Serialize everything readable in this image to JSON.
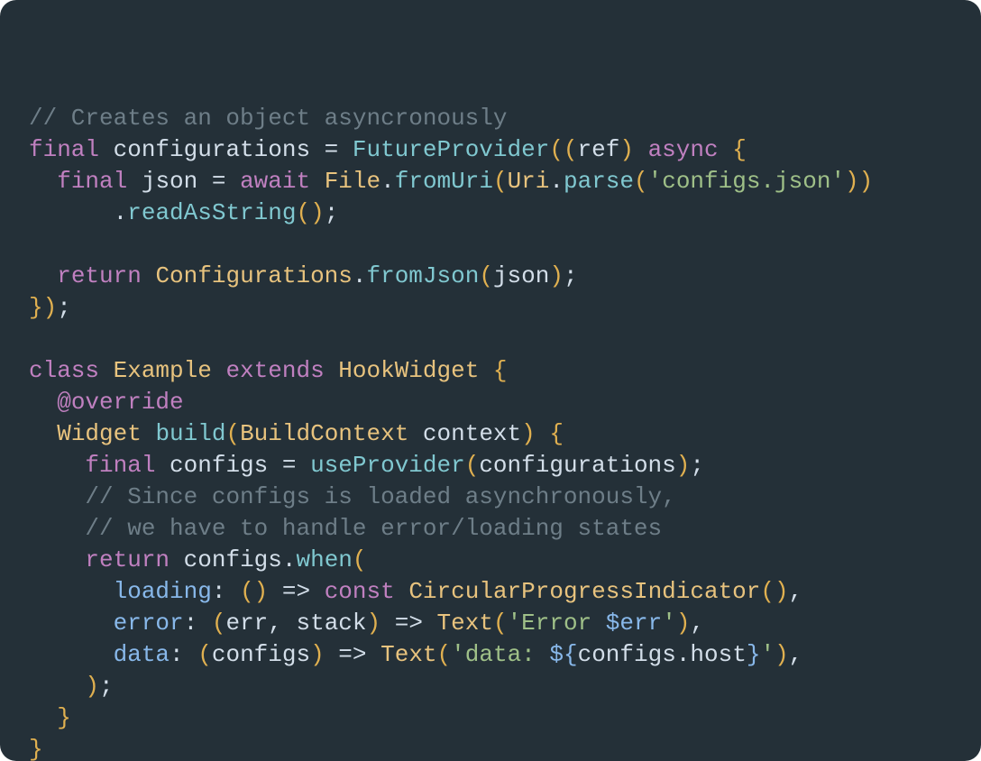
{
  "code": {
    "lines": [
      {
        "indent": 0,
        "tokens": [
          {
            "t": "// Creates an object asyncronously",
            "c": "c-comment"
          }
        ]
      },
      {
        "indent": 0,
        "tokens": [
          {
            "t": "final",
            "c": "c-keyword"
          },
          {
            "t": " ",
            "c": "c-ident"
          },
          {
            "t": "configurations",
            "c": "c-ident"
          },
          {
            "t": " = ",
            "c": "c-punct"
          },
          {
            "t": "FutureProvider",
            "c": "c-func"
          },
          {
            "t": "((",
            "c": "c-paren"
          },
          {
            "t": "ref",
            "c": "c-ident"
          },
          {
            "t": ")",
            "c": "c-paren"
          },
          {
            "t": " ",
            "c": "c-ident"
          },
          {
            "t": "async",
            "c": "c-keyword"
          },
          {
            "t": " ",
            "c": "c-ident"
          },
          {
            "t": "{",
            "c": "c-paren"
          }
        ]
      },
      {
        "indent": 1,
        "tokens": [
          {
            "t": "final",
            "c": "c-keyword"
          },
          {
            "t": " ",
            "c": "c-ident"
          },
          {
            "t": "json",
            "c": "c-ident"
          },
          {
            "t": " = ",
            "c": "c-punct"
          },
          {
            "t": "await",
            "c": "c-keyword"
          },
          {
            "t": " ",
            "c": "c-ident"
          },
          {
            "t": "File",
            "c": "c-type"
          },
          {
            "t": ".",
            "c": "c-punct"
          },
          {
            "t": "fromUri",
            "c": "c-func"
          },
          {
            "t": "(",
            "c": "c-paren"
          },
          {
            "t": "Uri",
            "c": "c-type"
          },
          {
            "t": ".",
            "c": "c-punct"
          },
          {
            "t": "parse",
            "c": "c-func"
          },
          {
            "t": "(",
            "c": "c-paren"
          },
          {
            "t": "'configs.json'",
            "c": "c-string"
          },
          {
            "t": "))",
            "c": "c-paren"
          }
        ]
      },
      {
        "indent": 3,
        "tokens": [
          {
            "t": ".",
            "c": "c-punct"
          },
          {
            "t": "readAsString",
            "c": "c-func"
          },
          {
            "t": "()",
            "c": "c-paren"
          },
          {
            "t": ";",
            "c": "c-punct"
          }
        ]
      },
      {
        "indent": 0,
        "tokens": []
      },
      {
        "indent": 1,
        "tokens": [
          {
            "t": "return",
            "c": "c-keyword"
          },
          {
            "t": " ",
            "c": "c-ident"
          },
          {
            "t": "Configurations",
            "c": "c-type"
          },
          {
            "t": ".",
            "c": "c-punct"
          },
          {
            "t": "fromJson",
            "c": "c-func"
          },
          {
            "t": "(",
            "c": "c-paren"
          },
          {
            "t": "json",
            "c": "c-ident"
          },
          {
            "t": ")",
            "c": "c-paren"
          },
          {
            "t": ";",
            "c": "c-punct"
          }
        ]
      },
      {
        "indent": 0,
        "tokens": [
          {
            "t": "})",
            "c": "c-paren"
          },
          {
            "t": ";",
            "c": "c-punct"
          }
        ]
      },
      {
        "indent": 0,
        "tokens": []
      },
      {
        "indent": 0,
        "tokens": [
          {
            "t": "class",
            "c": "c-keyword"
          },
          {
            "t": " ",
            "c": "c-ident"
          },
          {
            "t": "Example",
            "c": "c-type"
          },
          {
            "t": " ",
            "c": "c-ident"
          },
          {
            "t": "extends",
            "c": "c-keyword"
          },
          {
            "t": " ",
            "c": "c-ident"
          },
          {
            "t": "HookWidget",
            "c": "c-type"
          },
          {
            "t": " ",
            "c": "c-ident"
          },
          {
            "t": "{",
            "c": "c-paren"
          }
        ]
      },
      {
        "indent": 1,
        "tokens": [
          {
            "t": "@override",
            "c": "c-anno"
          }
        ]
      },
      {
        "indent": 1,
        "tokens": [
          {
            "t": "Widget",
            "c": "c-type"
          },
          {
            "t": " ",
            "c": "c-ident"
          },
          {
            "t": "build",
            "c": "c-func"
          },
          {
            "t": "(",
            "c": "c-paren"
          },
          {
            "t": "BuildContext",
            "c": "c-type"
          },
          {
            "t": " ",
            "c": "c-ident"
          },
          {
            "t": "context",
            "c": "c-ident"
          },
          {
            "t": ")",
            "c": "c-paren"
          },
          {
            "t": " ",
            "c": "c-ident"
          },
          {
            "t": "{",
            "c": "c-paren"
          }
        ]
      },
      {
        "indent": 2,
        "tokens": [
          {
            "t": "final",
            "c": "c-keyword"
          },
          {
            "t": " ",
            "c": "c-ident"
          },
          {
            "t": "configs",
            "c": "c-ident"
          },
          {
            "t": " = ",
            "c": "c-punct"
          },
          {
            "t": "useProvider",
            "c": "c-func"
          },
          {
            "t": "(",
            "c": "c-paren"
          },
          {
            "t": "configurations",
            "c": "c-ident"
          },
          {
            "t": ")",
            "c": "c-paren"
          },
          {
            "t": ";",
            "c": "c-punct"
          }
        ]
      },
      {
        "indent": 2,
        "tokens": [
          {
            "t": "// Since configs is loaded asynchronously,",
            "c": "c-comment"
          }
        ]
      },
      {
        "indent": 2,
        "tokens": [
          {
            "t": "// we have to handle error/loading states",
            "c": "c-comment"
          }
        ]
      },
      {
        "indent": 2,
        "tokens": [
          {
            "t": "return",
            "c": "c-keyword"
          },
          {
            "t": " ",
            "c": "c-ident"
          },
          {
            "t": "configs",
            "c": "c-ident"
          },
          {
            "t": ".",
            "c": "c-punct"
          },
          {
            "t": "when",
            "c": "c-func"
          },
          {
            "t": "(",
            "c": "c-paren"
          }
        ]
      },
      {
        "indent": 3,
        "tokens": [
          {
            "t": "loading",
            "c": "c-named"
          },
          {
            "t": ": ",
            "c": "c-punct"
          },
          {
            "t": "()",
            "c": "c-paren"
          },
          {
            "t": " => ",
            "c": "c-punct"
          },
          {
            "t": "const",
            "c": "c-keyword"
          },
          {
            "t": " ",
            "c": "c-ident"
          },
          {
            "t": "CircularProgressIndicator",
            "c": "c-type"
          },
          {
            "t": "()",
            "c": "c-paren"
          },
          {
            "t": ",",
            "c": "c-punct"
          }
        ]
      },
      {
        "indent": 3,
        "tokens": [
          {
            "t": "error",
            "c": "c-named"
          },
          {
            "t": ": ",
            "c": "c-punct"
          },
          {
            "t": "(",
            "c": "c-paren"
          },
          {
            "t": "err",
            "c": "c-ident"
          },
          {
            "t": ", ",
            "c": "c-punct"
          },
          {
            "t": "stack",
            "c": "c-ident"
          },
          {
            "t": ")",
            "c": "c-paren"
          },
          {
            "t": " => ",
            "c": "c-punct"
          },
          {
            "t": "Text",
            "c": "c-type"
          },
          {
            "t": "(",
            "c": "c-paren"
          },
          {
            "t": "'Error ",
            "c": "c-string"
          },
          {
            "t": "$err",
            "c": "c-interp"
          },
          {
            "t": "'",
            "c": "c-string"
          },
          {
            "t": ")",
            "c": "c-paren"
          },
          {
            "t": ",",
            "c": "c-punct"
          }
        ]
      },
      {
        "indent": 3,
        "tokens": [
          {
            "t": "data",
            "c": "c-named"
          },
          {
            "t": ": ",
            "c": "c-punct"
          },
          {
            "t": "(",
            "c": "c-paren"
          },
          {
            "t": "configs",
            "c": "c-ident"
          },
          {
            "t": ")",
            "c": "c-paren"
          },
          {
            "t": " => ",
            "c": "c-punct"
          },
          {
            "t": "Text",
            "c": "c-type"
          },
          {
            "t": "(",
            "c": "c-paren"
          },
          {
            "t": "'data: ",
            "c": "c-string"
          },
          {
            "t": "${",
            "c": "c-interp"
          },
          {
            "t": "configs",
            "c": "c-ident"
          },
          {
            "t": ".",
            "c": "c-punct"
          },
          {
            "t": "host",
            "c": "c-ident"
          },
          {
            "t": "}",
            "c": "c-interp"
          },
          {
            "t": "'",
            "c": "c-string"
          },
          {
            "t": ")",
            "c": "c-paren"
          },
          {
            "t": ",",
            "c": "c-punct"
          }
        ]
      },
      {
        "indent": 2,
        "tokens": [
          {
            "t": ")",
            "c": "c-paren"
          },
          {
            "t": ";",
            "c": "c-punct"
          }
        ]
      },
      {
        "indent": 1,
        "tokens": [
          {
            "t": "}",
            "c": "c-paren"
          }
        ]
      },
      {
        "indent": 0,
        "tokens": [
          {
            "t": "}",
            "c": "c-paren"
          }
        ]
      }
    ],
    "indent_unit": "  "
  }
}
